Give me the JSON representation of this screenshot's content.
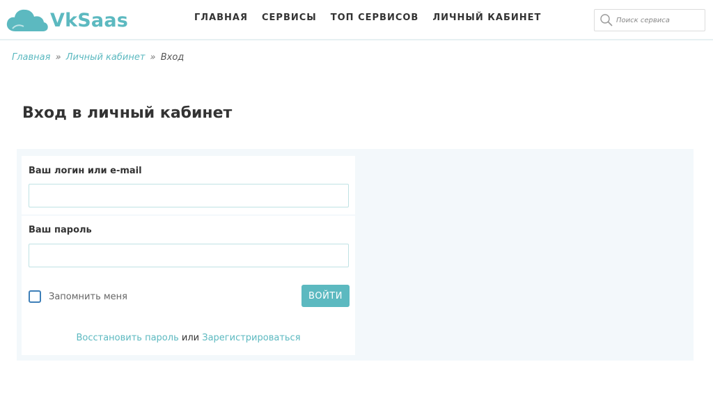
{
  "header": {
    "logo_text": "VkSaas",
    "nav": [
      "Главная",
      "Сервисы",
      "Топ сервисов",
      "Личный кабинет"
    ],
    "search": {
      "placeholder": "Поиск сервиса",
      "icon": "search-icon"
    }
  },
  "breadcrumb": {
    "home": "Главная",
    "separator": "»",
    "cabinet": "Личный кабинет",
    "current": "Вход"
  },
  "page": {
    "title": "Вход в личный кабинет"
  },
  "form": {
    "login_label": "Ваш логин или e-mail",
    "login_value": "",
    "password_label": "Ваш пароль",
    "password_value": "",
    "remember_label": "Запомнить меня",
    "remember_checked": false,
    "submit_label": "ВОЙТИ",
    "restore_link": "Восстановить пароль",
    "or_text": "или",
    "register_link": "Зарегистрироваться"
  },
  "colors": {
    "accent": "#5cb9c0",
    "panel_bg": "#f3f8fb",
    "checkbox_border": "#3e7fb8",
    "text": "#333333"
  }
}
